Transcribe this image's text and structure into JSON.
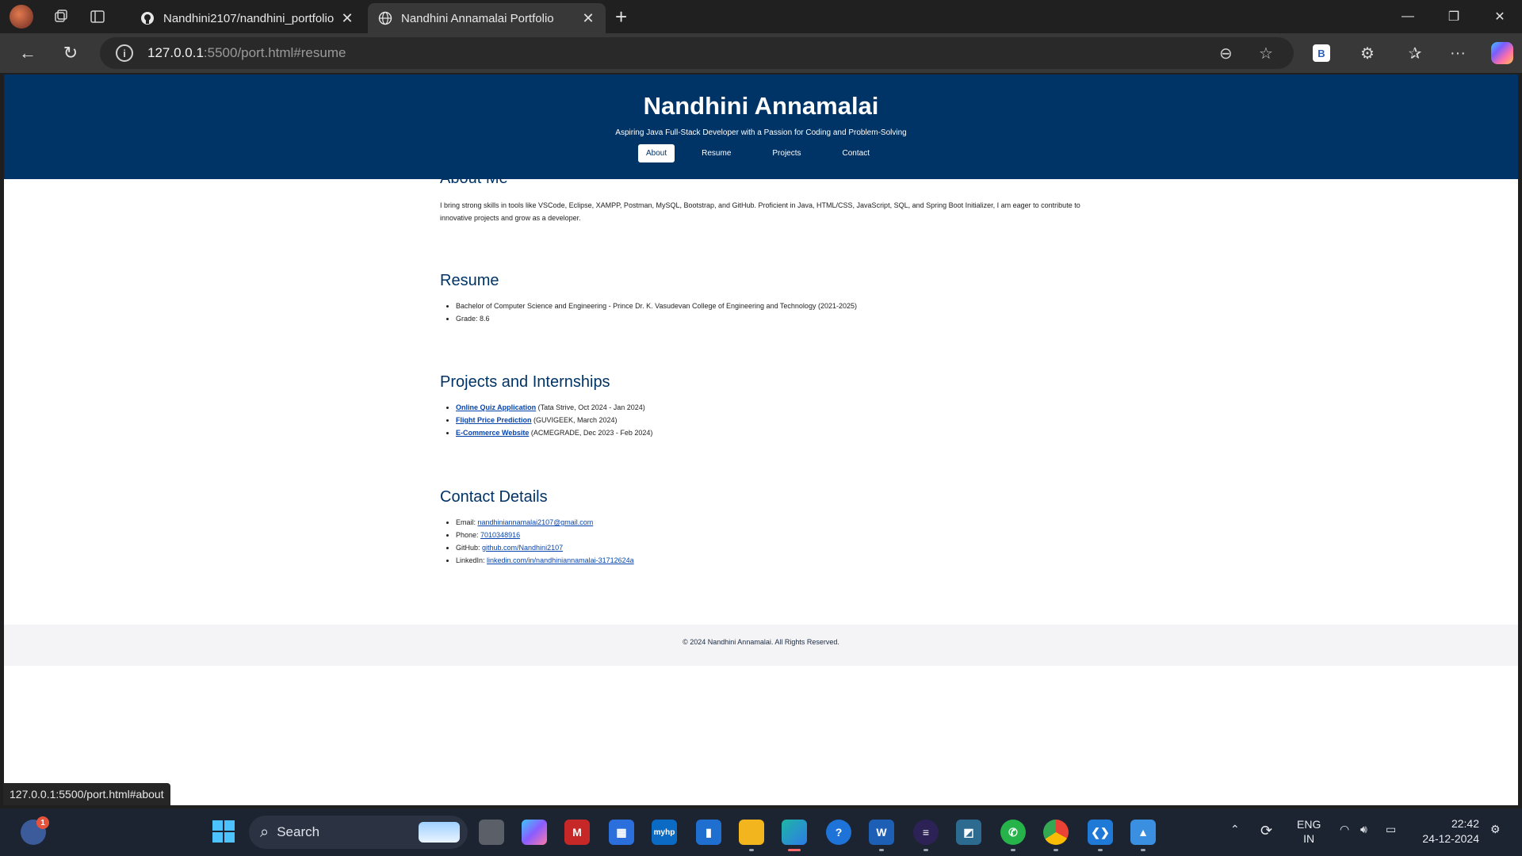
{
  "browser": {
    "tabs": [
      {
        "title": "Nandhini2107/nandhini_portfolio",
        "icon": "github-icon"
      },
      {
        "title": "Nandhini Annamalai Portfolio",
        "icon": "globe-icon"
      }
    ],
    "url_host": "127.0.0.1",
    "url_rest": ":5500/port.html#resume",
    "status_url": "127.0.0.1:5500/port.html#about",
    "extension_label": "B"
  },
  "site": {
    "name": "Nandhini Annamalai",
    "tagline": "Aspiring Java Full-Stack Developer with a Passion for Coding and Problem-Solving",
    "nav": [
      "About",
      "Resume",
      "Projects",
      "Contact"
    ],
    "active_nav": "About",
    "about": {
      "heading": "About Me",
      "text": "I bring strong skills in tools like VSCode, Eclipse, XAMPP, Postman, MySQL, Bootstrap, and GitHub. Proficient in Java, HTML/CSS, JavaScript, SQL, and Spring Boot Initializer, I am eager to contribute to innovative projects and grow as a developer."
    },
    "resume": {
      "heading": "Resume",
      "items": [
        "Bachelor of Computer Science and Engineering - Prince Dr. K. Vasudevan College of Engineering and Technology (2021-2025)",
        "Grade: 8.6"
      ]
    },
    "projects": {
      "heading": "Projects and Internships",
      "items": [
        {
          "link": "Online Quiz Application",
          "detail": " (Tata Strive, Oct 2024 - Jan 2024)"
        },
        {
          "link": "Flight Price Prediction",
          "detail": " (GUVIGEEK, March 2024)"
        },
        {
          "link": "E-Commerce Website",
          "detail": " (ACMEGRADE, Dec 2023 - Feb 2024)"
        }
      ]
    },
    "contact": {
      "heading": "Contact Details",
      "items": [
        {
          "label": "Email: ",
          "value": "nandhiniannamalai2107@gmail.com"
        },
        {
          "label": "Phone: ",
          "value": "7010348916"
        },
        {
          "label": "GitHub: ",
          "value": "github.com/Nandhini2107"
        },
        {
          "label": "LinkedIn: ",
          "value": "linkedin.com/in/nandhiniannamalai-31712624a"
        }
      ]
    },
    "footer": "© 2024 Nandhini Annamalai. All Rights Reserved."
  },
  "taskbar": {
    "search_placeholder": "Search",
    "weather_badge": "1",
    "language_line1": "ENG",
    "language_line2": "IN",
    "time": "22:42",
    "date": "24-12-2024",
    "mypc_label": "myhp"
  },
  "colors": {
    "header_bg": "#003366",
    "accent": "#003366",
    "link": "#0645ad"
  }
}
